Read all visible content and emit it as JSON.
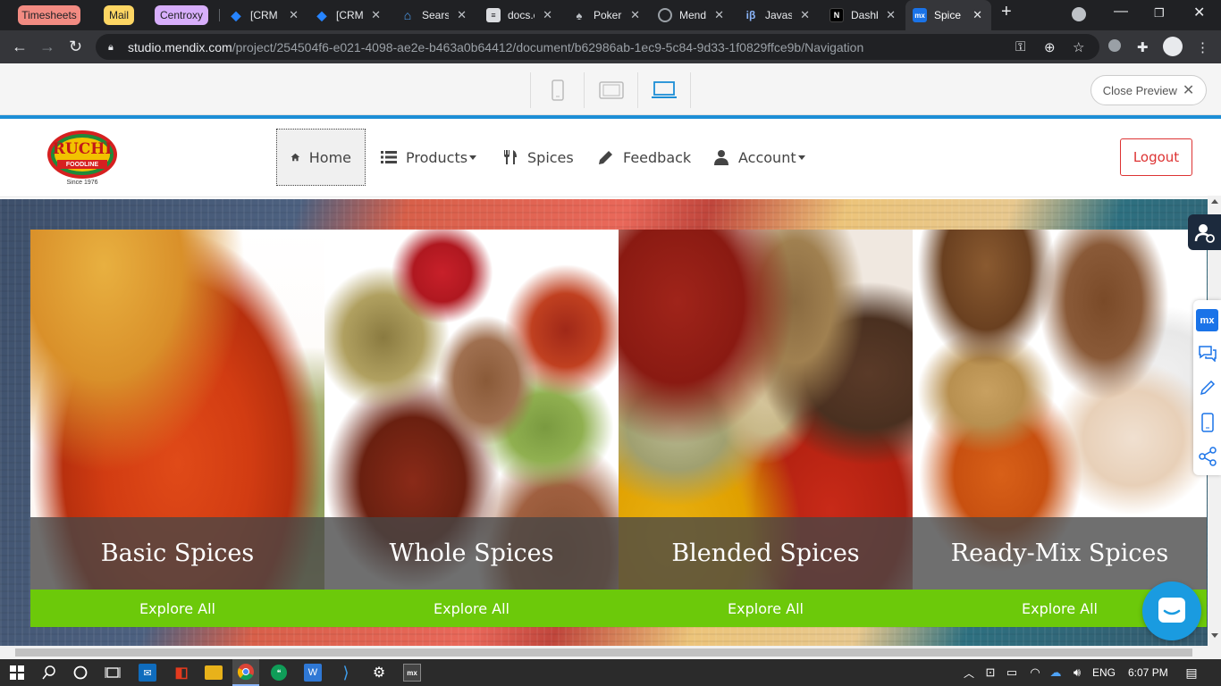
{
  "browser": {
    "groups": [
      {
        "label": "Timesheets",
        "color": "#f28b82"
      },
      {
        "label": "Mail",
        "color": "#fdd663"
      },
      {
        "label": "Centroxy",
        "color": "#d7aefb"
      }
    ],
    "tabs": [
      {
        "title": "[CRM",
        "icon": "jira-icon"
      },
      {
        "title": "[CRM",
        "icon": "jira-icon"
      },
      {
        "title": "Sears",
        "icon": "sears-icon"
      },
      {
        "title": "docs.c",
        "icon": "docs-icon"
      },
      {
        "title": "Poker",
        "icon": "poker-icon"
      },
      {
        "title": "Mend",
        "icon": "globe-icon"
      },
      {
        "title": "Javasc",
        "icon": "ib-icon"
      },
      {
        "title": "Dashb",
        "icon": "dashboard-icon"
      },
      {
        "title": "Spice",
        "icon": "mx-icon",
        "active": true
      }
    ],
    "url_host": "studio.mendix.com",
    "url_path": "/project/254504f6-e021-4098-ae2e-b463a0b64412/document/b62986ab-1ec9-5c84-9d33-1f0829ffce9b/Navigation"
  },
  "preview": {
    "close_label": "Close Preview"
  },
  "app": {
    "logo": {
      "brand": "RUCHI",
      "sub": "FOODLINE",
      "since": "Since 1976"
    },
    "nav": [
      {
        "label": "Home",
        "icon": "home-icon",
        "active": true
      },
      {
        "label": "Products",
        "icon": "list-icon",
        "dropdown": true
      },
      {
        "label": "Spices",
        "icon": "cutlery-icon"
      },
      {
        "label": "Feedback",
        "icon": "pencil-icon"
      },
      {
        "label": "Account",
        "icon": "user-icon",
        "dropdown": true
      }
    ],
    "logout_label": "Logout",
    "cards": [
      {
        "title": "Basic Spices",
        "button": "Explore All"
      },
      {
        "title": "Whole Spices",
        "button": "Explore All"
      },
      {
        "title": "Blended Spices",
        "button": "Explore All"
      },
      {
        "title": "Ready-Mix Spices",
        "button": "Explore All"
      }
    ],
    "accent": "#6cc90a"
  },
  "taskbar": {
    "language": "ENG",
    "time": "6:07 PM"
  }
}
